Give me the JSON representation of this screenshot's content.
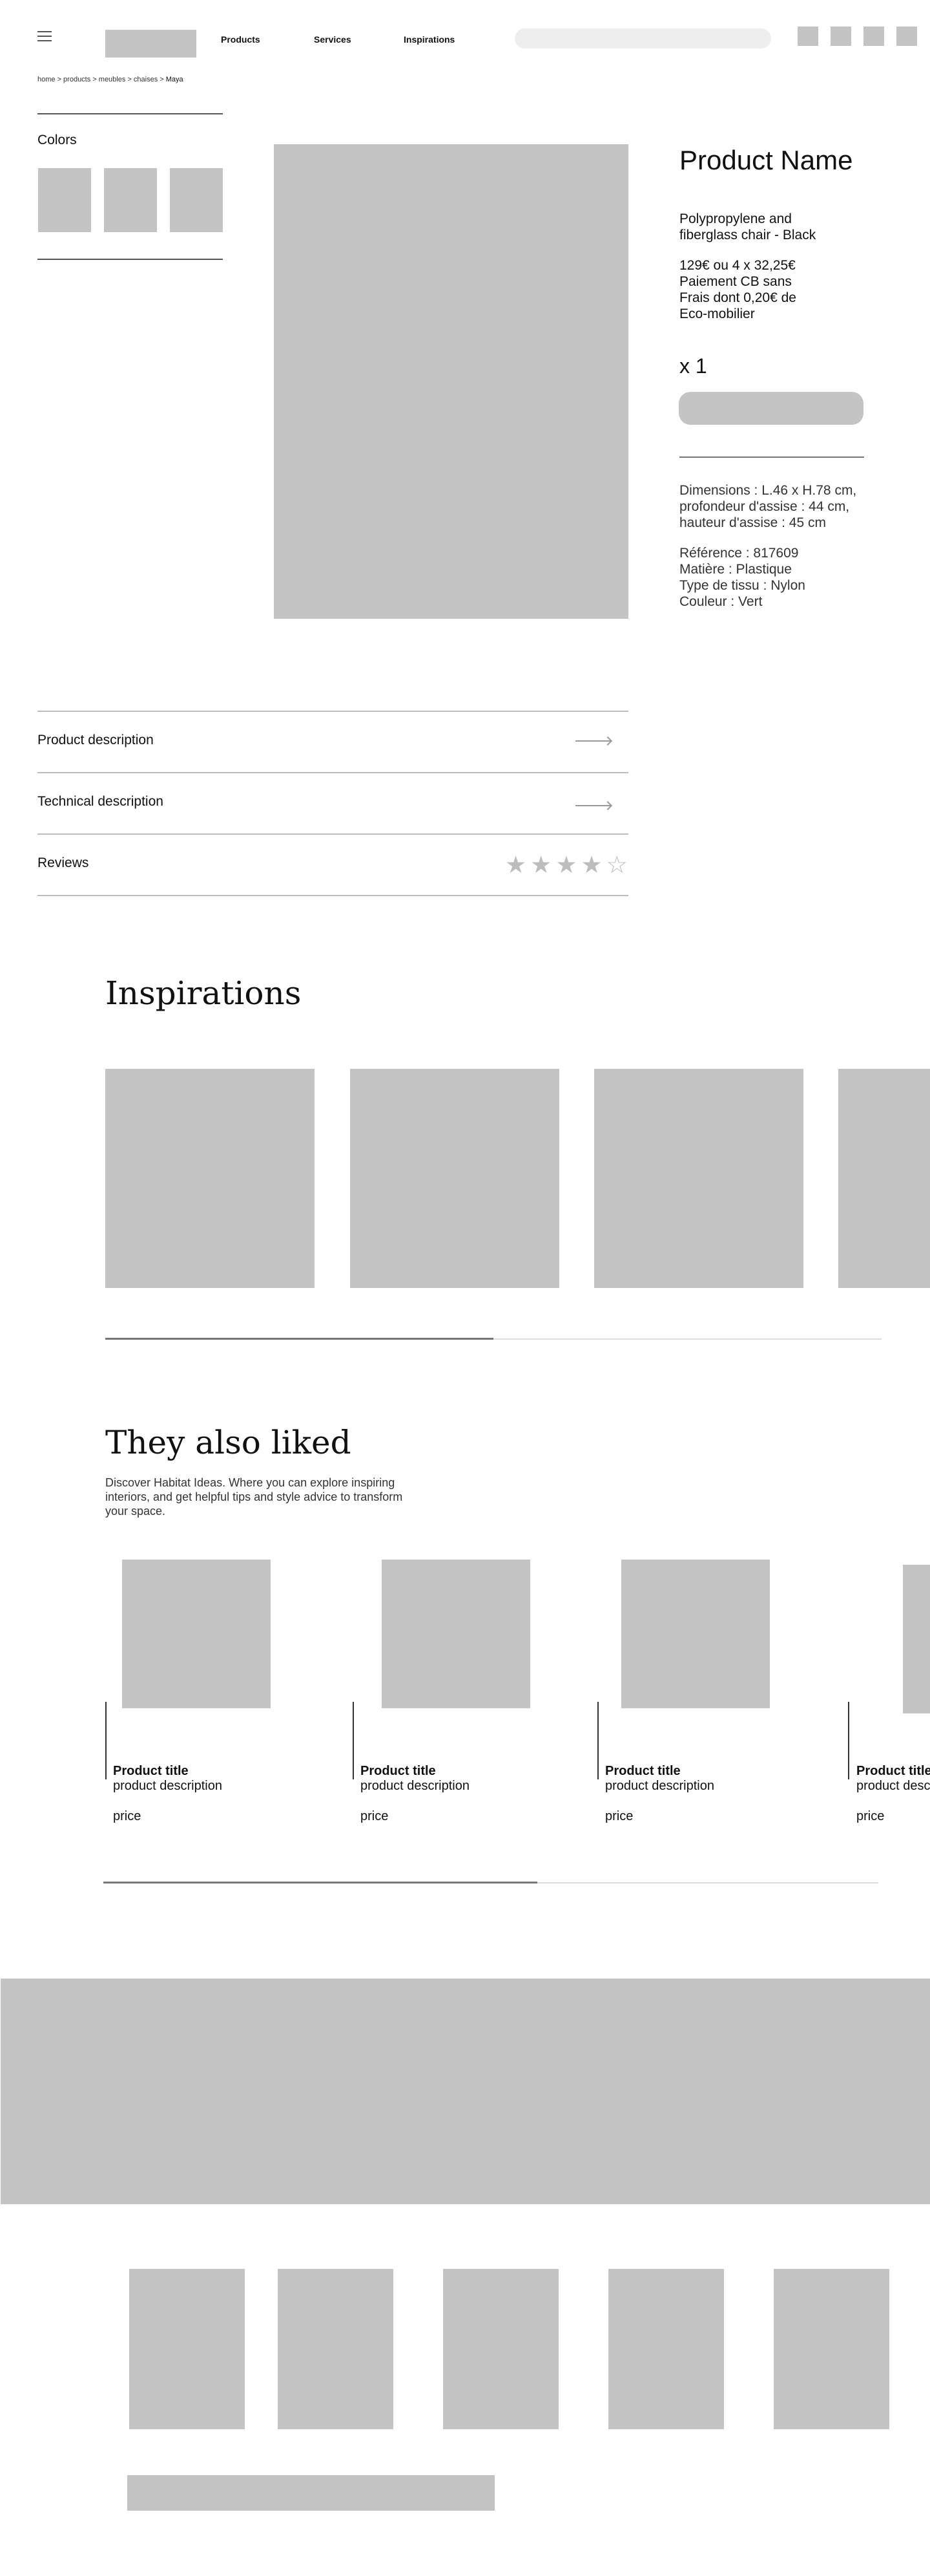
{
  "header": {
    "menu_icon": "hamburger-icon",
    "nav": [
      "Products",
      "Services",
      "Inspirations"
    ],
    "icons": [
      "account-icon",
      "wishlist-icon",
      "store-icon",
      "cart-icon"
    ]
  },
  "breadcrumb": {
    "path": "home > products > meubles > chaises > ",
    "current": "Maya"
  },
  "colors": {
    "label": "Colors",
    "swatch_count": 3
  },
  "product": {
    "name": "Product Name",
    "subtitle_lines": [
      "Polypropylene and",
      "fiberglass chair - Black"
    ],
    "price_lines": [
      "129€ ou 4 x 32,25€",
      "Paiement CB sans",
      "Frais dont 0,20€ de",
      "Eco-mobilier"
    ],
    "quantity": "x 1",
    "dimension_lines": [
      "Dimensions : L.46 x H.78 cm,",
      "profondeur d'assise : 44 cm,",
      "hauteur d'assise : 45 cm"
    ],
    "detail_lines": [
      "Référence : 817609",
      "Matière : Plastique",
      "Type de tissu : Nylon",
      "Couleur : Vert"
    ]
  },
  "accordion": {
    "product_description": "Product description",
    "technical_description": "Technical description",
    "reviews": "Reviews",
    "stars": "★★★★☆",
    "rating": 4
  },
  "inspirations": {
    "title": "Inspirations",
    "scroll_progress": 0.5
  },
  "liked": {
    "title": "They also liked",
    "description_lines": [
      "Discover Habitat Ideas. Where you can explore inspiring",
      "interiors, and get helpful tips and style advice to transform",
      "your space."
    ],
    "cards": [
      {
        "title": "Product title",
        "description": "product description",
        "price": "price"
      },
      {
        "title": "Product title",
        "description": "product description",
        "price": "price"
      },
      {
        "title": "Product title",
        "description": "product description",
        "price": "price"
      },
      {
        "title": "Product title",
        "description": "product description",
        "price": "price"
      }
    ],
    "scroll_progress": 0.56
  }
}
